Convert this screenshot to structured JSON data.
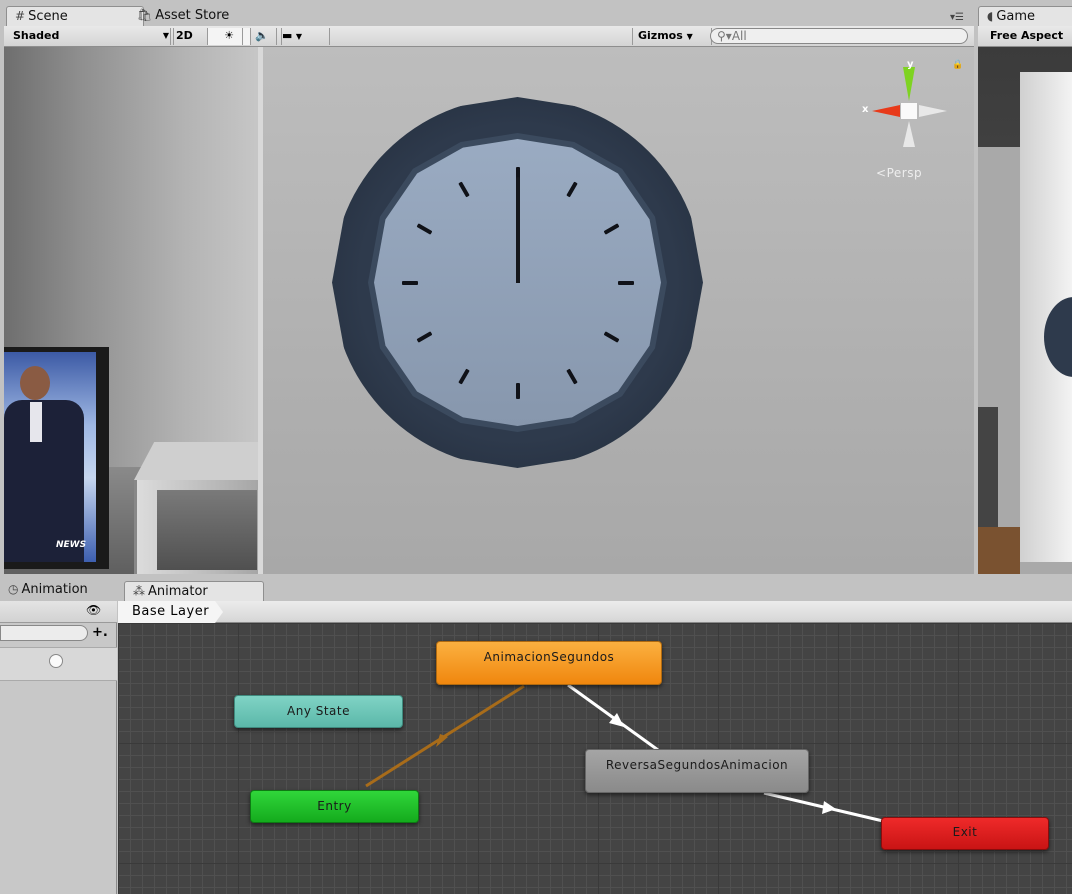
{
  "scene_panel": {
    "tabs": [
      {
        "label": "Scene",
        "icon": "hash-icon"
      },
      {
        "label": "Asset Store",
        "icon": "shopping-bag-icon"
      }
    ],
    "toolbar": {
      "shading_mode": "Shaded",
      "mode_2d": "2D",
      "gizmos": "Gizmos",
      "search_placeholder": "All"
    },
    "gizmo": {
      "y": "y",
      "x": "x",
      "projection": "Persp"
    }
  },
  "game_panel": {
    "tab": "Game",
    "aspect": "Free Aspect"
  },
  "bottom_panel": {
    "tabs": [
      {
        "label": "Animation",
        "icon": "clock-icon"
      },
      {
        "label": "Animator",
        "icon": "animator-icon"
      }
    ],
    "breadcrumb": "Base Layer"
  },
  "animator": {
    "states": {
      "main": "AnimacionSegundos",
      "any": "Any State",
      "entry": "Entry",
      "reverse": "ReversaSegundosAnimacion",
      "exit": "Exit"
    },
    "colors": {
      "default_state": "#f5921b",
      "any_state": "#6bc5b7",
      "entry": "#22c22a",
      "state": "#8a8a8a",
      "exit": "#d81818",
      "default_transition": "#a86c1a",
      "transition": "#ffffff"
    }
  },
  "tv_overlay": "NEWS"
}
